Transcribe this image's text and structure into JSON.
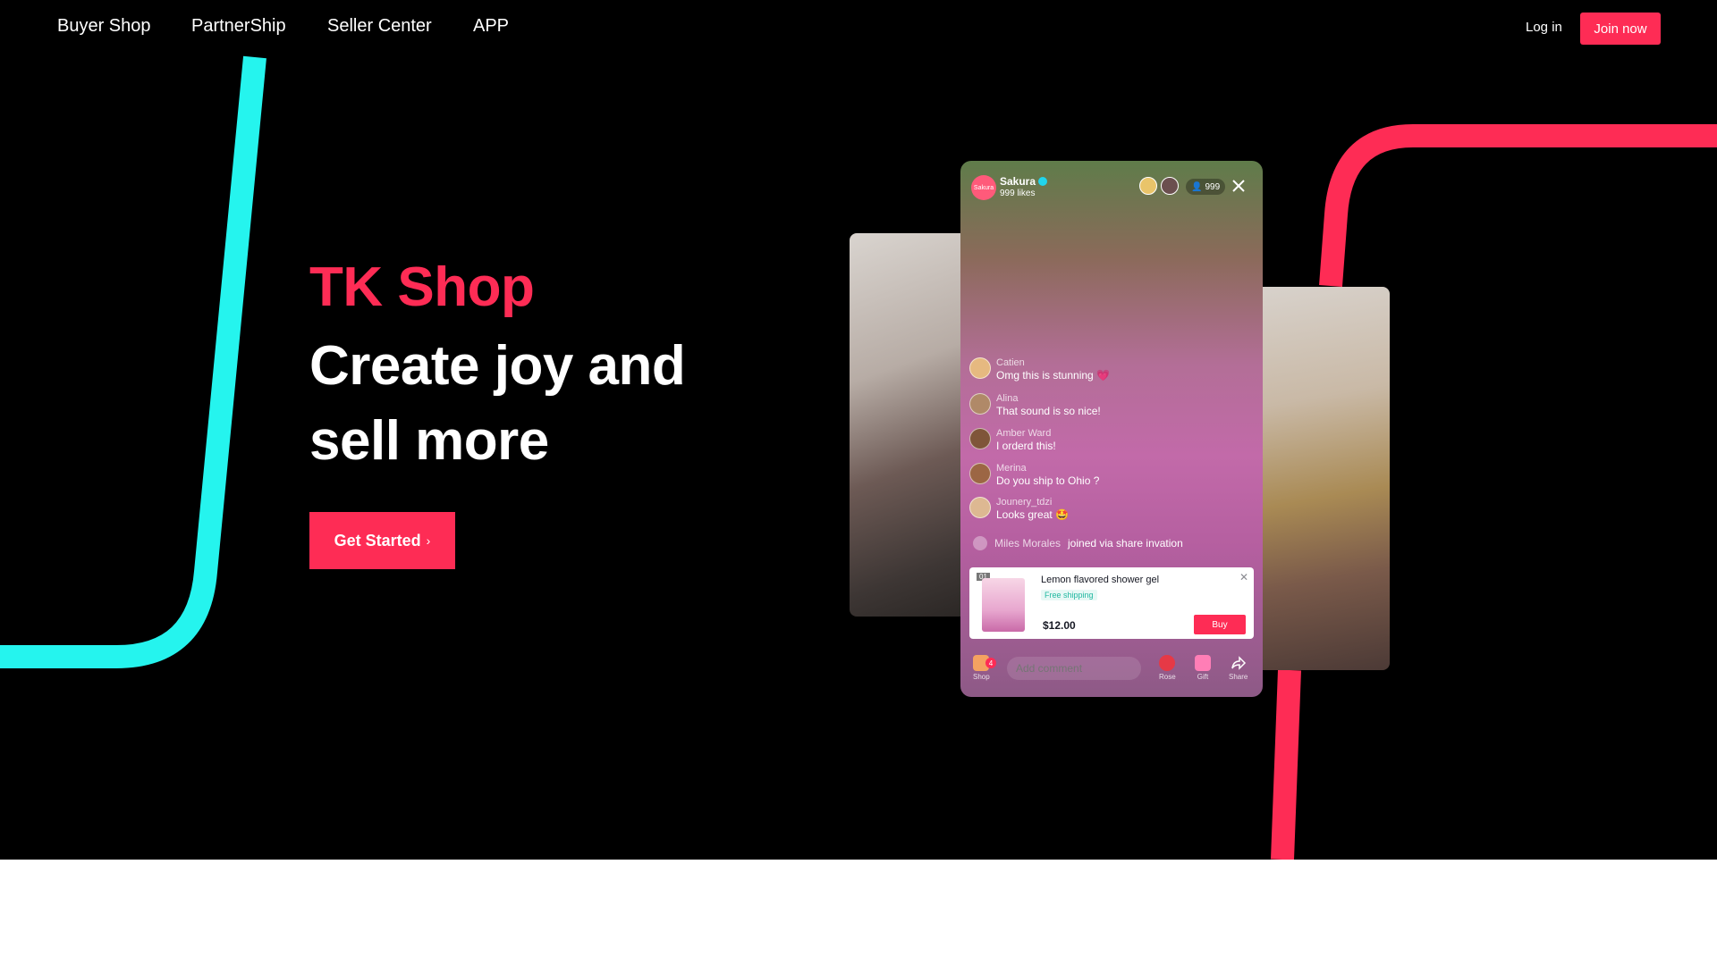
{
  "nav": {
    "items": [
      "Buyer Shop",
      "PartnerShip",
      "Seller Center",
      "APP"
    ],
    "login": "Log in",
    "join": "Join now"
  },
  "hero": {
    "brand": "TK Shop",
    "headline_line1": "Create joy and",
    "headline_line2": "sell more",
    "cta": "Get Started",
    "cta_icon": "chevron-right-icon"
  },
  "live": {
    "host_avatar_text": "Sakura",
    "host_name": "Sakura",
    "host_likes": "999 likes",
    "viewer_count": "999",
    "comments": [
      {
        "name": "Catien",
        "message": "Omg this is stunning 💗"
      },
      {
        "name": "Alina",
        "message": "That sound is so nice!"
      },
      {
        "name": "Amber Ward",
        "message": "I orderd this!"
      },
      {
        "name": "Merina",
        "message": "Do you ship to Ohio ?"
      },
      {
        "name": "Jounery_tdzi",
        "message": "Looks great 🤩"
      }
    ],
    "join_name": "Miles Morales",
    "join_text": "joined via share invation",
    "product": {
      "index": "01",
      "title": "Lemon flavored shower gel",
      "shipping": "Free shipping",
      "price": "$12.00",
      "buy": "Buy"
    },
    "comment_placeholder": "Add comment",
    "shop_badge": "4",
    "bottom": {
      "shop": "Shop",
      "rose": "Rose",
      "gift": "Gift",
      "share": "Share"
    }
  },
  "colors": {
    "accent_red": "#fe2c55",
    "accent_cyan": "#25f4ee"
  }
}
